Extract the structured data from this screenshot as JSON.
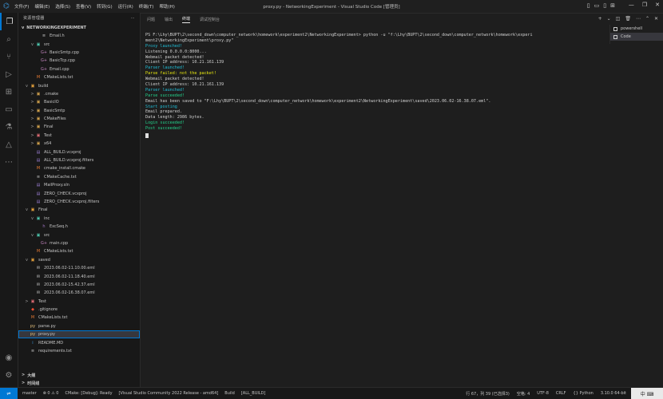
{
  "titlebar": {
    "menus": [
      "文件(F)",
      "编辑(E)",
      "选择(S)",
      "查看(V)",
      "转到(G)",
      "运行(R)",
      "终端(T)",
      "帮助(H)"
    ],
    "window_title": "proxy.py - NetworkingExperiment - Visual Studio Code [管理员]"
  },
  "sidebar": {
    "header": "资源管理器",
    "section": "NETWORKINGEXPERIMENT",
    "items": [
      {
        "indent": 3,
        "chev": "",
        "icon": "≡",
        "color": "#cccccc",
        "label": "Email.h"
      },
      {
        "indent": 2,
        "chev": "v",
        "icon": "▣",
        "color": "#4ec9b0",
        "label": "src"
      },
      {
        "indent": 3,
        "chev": "",
        "icon": "G+",
        "color": "#c586c0",
        "label": "BasicSmtp.cpp"
      },
      {
        "indent": 3,
        "chev": "",
        "icon": "G+",
        "color": "#c586c0",
        "label": "BasicTcp.cpp"
      },
      {
        "indent": 3,
        "chev": "",
        "icon": "G+",
        "color": "#c586c0",
        "label": "Email.cpp"
      },
      {
        "indent": 2,
        "chev": "",
        "icon": "M",
        "color": "#e37933",
        "label": "CMakeLists.txt"
      },
      {
        "indent": 1,
        "chev": "v",
        "icon": "▣",
        "color": "#e8a33d",
        "label": "build"
      },
      {
        "indent": 2,
        "chev": ">",
        "icon": "▣",
        "color": "#d2a24c",
        "label": ".cmake"
      },
      {
        "indent": 2,
        "chev": ">",
        "icon": "▣",
        "color": "#d2a24c",
        "label": "BasicIO"
      },
      {
        "indent": 2,
        "chev": ">",
        "icon": "▣",
        "color": "#d2a24c",
        "label": "BasicSmtp"
      },
      {
        "indent": 2,
        "chev": ">",
        "icon": "▣",
        "color": "#d2a24c",
        "label": "CMakeFiles"
      },
      {
        "indent": 2,
        "chev": ">",
        "icon": "▣",
        "color": "#d2a24c",
        "label": "Final"
      },
      {
        "indent": 2,
        "chev": ">",
        "icon": "▣",
        "color": "#e06c75",
        "label": "Test"
      },
      {
        "indent": 2,
        "chev": ">",
        "icon": "▣",
        "color": "#d2a24c",
        "label": "x64"
      },
      {
        "indent": 2,
        "chev": "",
        "icon": "▤",
        "color": "#9b7fd4",
        "label": "ALL_BUILD.vcxproj"
      },
      {
        "indent": 2,
        "chev": "",
        "icon": "▤",
        "color": "#9b7fd4",
        "label": "ALL_BUILD.vcxproj.filters"
      },
      {
        "indent": 2,
        "chev": "",
        "icon": "M",
        "color": "#e37933",
        "label": "cmake_install.cmake"
      },
      {
        "indent": 2,
        "chev": "",
        "icon": "≡",
        "color": "#cccccc",
        "label": "CMakeCache.txt"
      },
      {
        "indent": 2,
        "chev": "",
        "icon": "▤",
        "color": "#9b7fd4",
        "label": "MailProxy.sln"
      },
      {
        "indent": 2,
        "chev": "",
        "icon": "▤",
        "color": "#9b7fd4",
        "label": "ZERO_CHECK.vcxproj"
      },
      {
        "indent": 2,
        "chev": "",
        "icon": "▤",
        "color": "#9b7fd4",
        "label": "ZERO_CHECK.vcxproj.filters"
      },
      {
        "indent": 1,
        "chev": "v",
        "icon": "▣",
        "color": "#e8a33d",
        "label": "Final"
      },
      {
        "indent": 2,
        "chev": "v",
        "icon": "▣",
        "color": "#4ec9b0",
        "label": "inc"
      },
      {
        "indent": 3,
        "chev": "",
        "icon": "h",
        "color": "#a074c4",
        "label": "ExcSeq.h"
      },
      {
        "indent": 2,
        "chev": "v",
        "icon": "▣",
        "color": "#4ec9b0",
        "label": "src"
      },
      {
        "indent": 3,
        "chev": "",
        "icon": "G+",
        "color": "#c586c0",
        "label": "main.cpp"
      },
      {
        "indent": 2,
        "chev": "",
        "icon": "M",
        "color": "#e37933",
        "label": "CMakeLists.txt"
      },
      {
        "indent": 1,
        "chev": "v",
        "icon": "▣",
        "color": "#e8a33d",
        "label": "saved"
      },
      {
        "indent": 2,
        "chev": "",
        "icon": "✉",
        "color": "#cccccc",
        "label": "2023.06.02-11.10.00.eml"
      },
      {
        "indent": 2,
        "chev": "",
        "icon": "✉",
        "color": "#cccccc",
        "label": "2023.06.02-11.18.40.eml"
      },
      {
        "indent": 2,
        "chev": "",
        "icon": "✉",
        "color": "#cccccc",
        "label": "2023.06.02-15.42.37.eml"
      },
      {
        "indent": 2,
        "chev": "",
        "icon": "✉",
        "color": "#cccccc",
        "label": "2023.06.02-16.38.07.eml"
      },
      {
        "indent": 1,
        "chev": ">",
        "icon": "▣",
        "color": "#e06c75",
        "label": "Test"
      },
      {
        "indent": 1,
        "chev": "",
        "icon": "◆",
        "color": "#f14e32",
        "label": ".gitignore"
      },
      {
        "indent": 1,
        "chev": "",
        "icon": "M",
        "color": "#e37933",
        "label": "CMakeLists.txt"
      },
      {
        "indent": 1,
        "chev": "",
        "icon": "py",
        "color": "#e5c07b",
        "label": "parse.py"
      },
      {
        "indent": 1,
        "chev": "",
        "icon": "py",
        "color": "#e5c07b",
        "label": "proxy.py",
        "selected": true
      },
      {
        "indent": 1,
        "chev": "",
        "icon": "i",
        "color": "#3b9ae1",
        "label": "README.MD"
      },
      {
        "indent": 1,
        "chev": "",
        "icon": "≡",
        "color": "#cccccc",
        "label": "requirements.txt"
      }
    ],
    "outline": "大纲",
    "timeline": "时间线"
  },
  "panel": {
    "tabs": [
      "问题",
      "输出",
      "终端",
      "调试控制台"
    ],
    "active_tab": 2,
    "terminals": [
      "powershell",
      "Code"
    ]
  },
  "terminal": {
    "lines": [
      {
        "c": "c-white",
        "t": "PS F:\\Lhy\\BUPT\\2\\second_down\\computer_network\\homework\\experiment2\\NetworkingExperiment> python -u \"f:\\Lhy\\BUPT\\2\\second_down\\computer_network\\homework\\experi"
      },
      {
        "c": "c-white",
        "t": "ment2\\NetworkingExperiment\\proxy.py\""
      },
      {
        "c": "c-cyan",
        "t": "Proxy launched!"
      },
      {
        "c": "c-white",
        "t": "Listening 0.0.0.0:8000..."
      },
      {
        "c": "c-white",
        "t": "Webmail packet detected!"
      },
      {
        "c": "c-white",
        "t": "Client IP address: 10.21.161.139"
      },
      {
        "c": "c-cyan",
        "t": "Parser launched!"
      },
      {
        "c": "c-yellow",
        "t": "Parse failed: not the packet!"
      },
      {
        "c": "c-white",
        "t": "Webmail packet detected!"
      },
      {
        "c": "c-white",
        "t": "Client IP address: 10.21.161.139"
      },
      {
        "c": "c-cyan",
        "t": "Parser launched!"
      },
      {
        "c": "c-green",
        "t": "Parse succeeded!"
      },
      {
        "c": "c-white",
        "t": "Email has been saved to \"F:\\Lhy\\BUPT\\2\\second_down\\computer_network\\homework\\experiment2\\NetworkingExperiment\\saved\\2023.06.02-16.38.07.eml\"."
      },
      {
        "c": "c-cyan",
        "t": "Start posting"
      },
      {
        "c": "c-white",
        "t": "Email prepared."
      },
      {
        "c": "c-white",
        "t": "Data length: 2986 bytes."
      },
      {
        "c": "c-green",
        "t": "Login succeeded!"
      },
      {
        "c": "c-green",
        "t": "Post succeeded!"
      }
    ]
  },
  "statusbar": {
    "left": [
      "master",
      "⊗ 0 ⚠ 0",
      "CMake: [Debug]: Ready",
      "[Visual Studio Community 2022 Release - amd64]",
      "Build",
      "[ALL_BUILD]"
    ],
    "right": [
      "行 67，列 39 (已选择3)",
      "空格: 4",
      "UTF-8",
      "CRLF",
      "{} Python",
      "3.10.0 64-bit"
    ],
    "ime": "中 ⌨"
  }
}
